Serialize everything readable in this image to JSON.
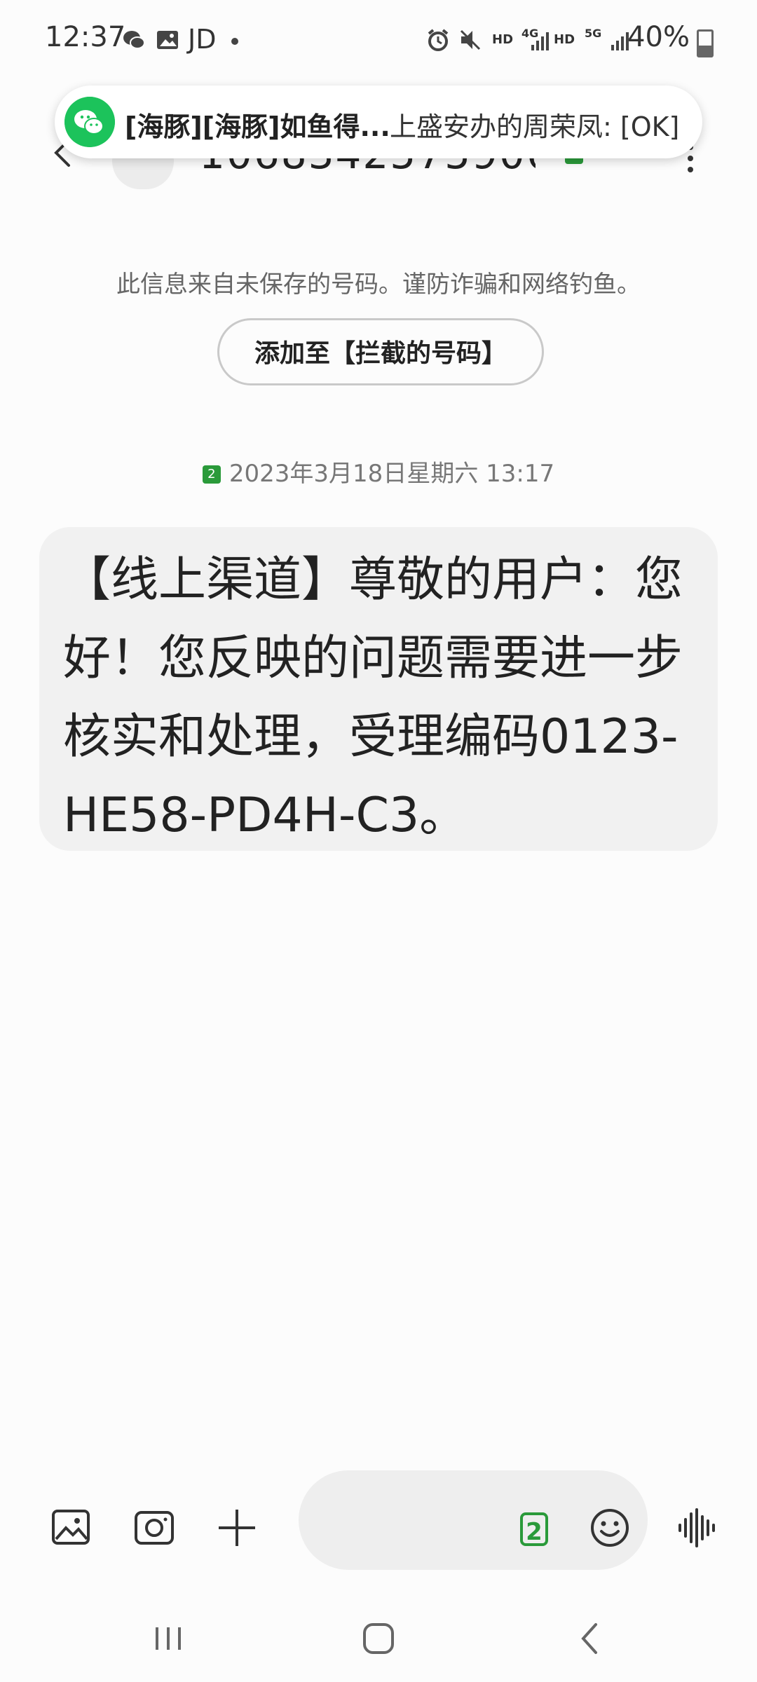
{
  "status_bar": {
    "time": "12:37",
    "carrier_tag": "JD",
    "hd1": "HD",
    "net1": "4G",
    "hd2": "HD",
    "net2": "5G",
    "battery": "40%"
  },
  "header": {
    "contact_number": "1068342575906...",
    "sim": "2"
  },
  "notification": {
    "title": "[海豚][海豚]如鱼得...",
    "message": "上盛安办的周荣凤: [OK]"
  },
  "warning": {
    "text": "此信息来自未保存的号码。谨防诈骗和网络钓鱼。",
    "block_button": "添加至【拦截的号码】"
  },
  "message": {
    "sim": "2",
    "date": "2023年3月18日星期六 13:17",
    "body": "【线上渠道】尊敬的用户：您好！您反映的问题需要进一步核实和处理，受理编码0123-HE58-PD4H-C3。"
  },
  "composer": {
    "sim": "2"
  },
  "colors": {
    "accent_green": "#2a9a3a",
    "wechat_green": "#1cc35b"
  }
}
